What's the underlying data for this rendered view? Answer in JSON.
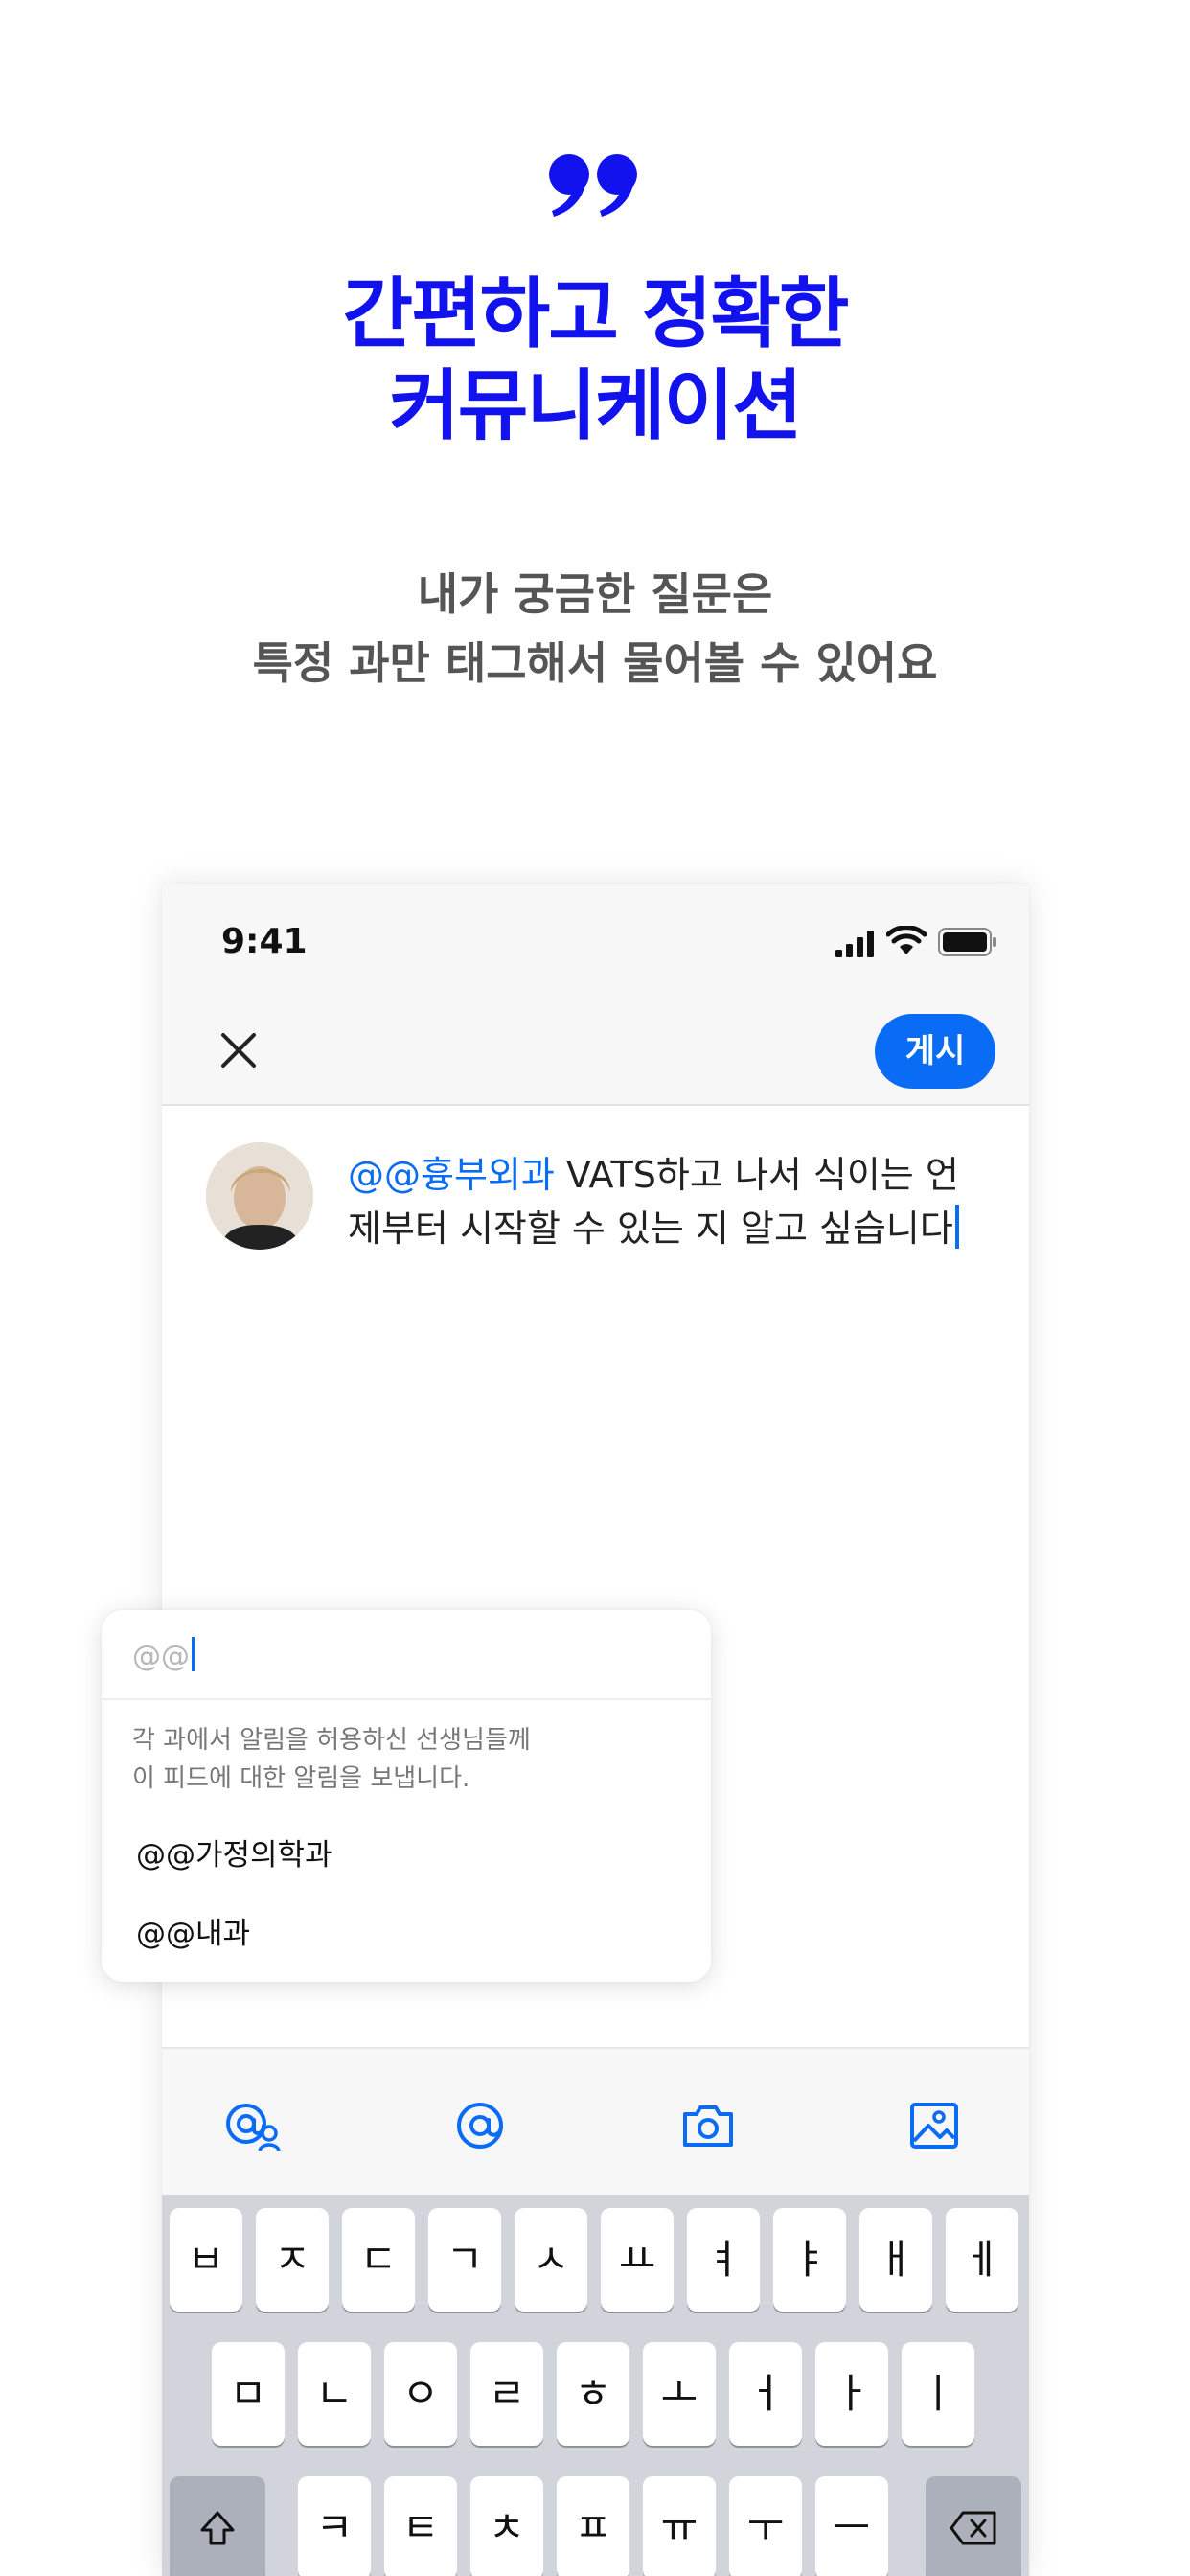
{
  "colors": {
    "accent_blue": "#1212ee",
    "button_blue": "#0a6cf5",
    "subtitle_gray": "#555555"
  },
  "header": {
    "quote_icon": "quote-icon",
    "headline_line1": "간편하고 정확한",
    "headline_line2": "커뮤니케이션",
    "subline_line1": "내가 궁금한 질문은",
    "subline_line2": "특정 과만 태그해서 물어볼 수 있어요"
  },
  "phone": {
    "status": {
      "time": "9:41"
    },
    "nav": {
      "close_icon": "close-icon",
      "post_label": "게시"
    },
    "compose": {
      "mention": "@@흉부외과",
      "line1_rest": " VATS하고 나서 식이는 언",
      "line2": "제부터 시작할 수 있는 지 알고 싶습니다"
    },
    "mention_popup": {
      "input_value": "@@",
      "description_line1": "각 과에서 알림을 허용하신 선생님들께",
      "description_line2": "이 피드에 대한 알림을 보냅니다.",
      "options": [
        "@@가정의학과",
        "@@내과"
      ]
    },
    "toolbar": {
      "icons": [
        "mention-group-icon",
        "mention-icon",
        "camera-icon",
        "image-icon"
      ]
    },
    "keyboard": {
      "row1": [
        "ㅂ",
        "ㅈ",
        "ㄷ",
        "ㄱ",
        "ㅅ",
        "ㅛ",
        "ㅕ",
        "ㅑ",
        "ㅐ",
        "ㅔ"
      ],
      "row2": [
        "ㅁ",
        "ㄴ",
        "ㅇ",
        "ㄹ",
        "ㅎ",
        "ㅗ",
        "ㅓ",
        "ㅏ",
        "ㅣ"
      ],
      "row3": [
        "ㅋ",
        "ㅌ",
        "ㅊ",
        "ㅍ",
        "ㅠ",
        "ㅜ",
        "ㅡ"
      ]
    }
  }
}
